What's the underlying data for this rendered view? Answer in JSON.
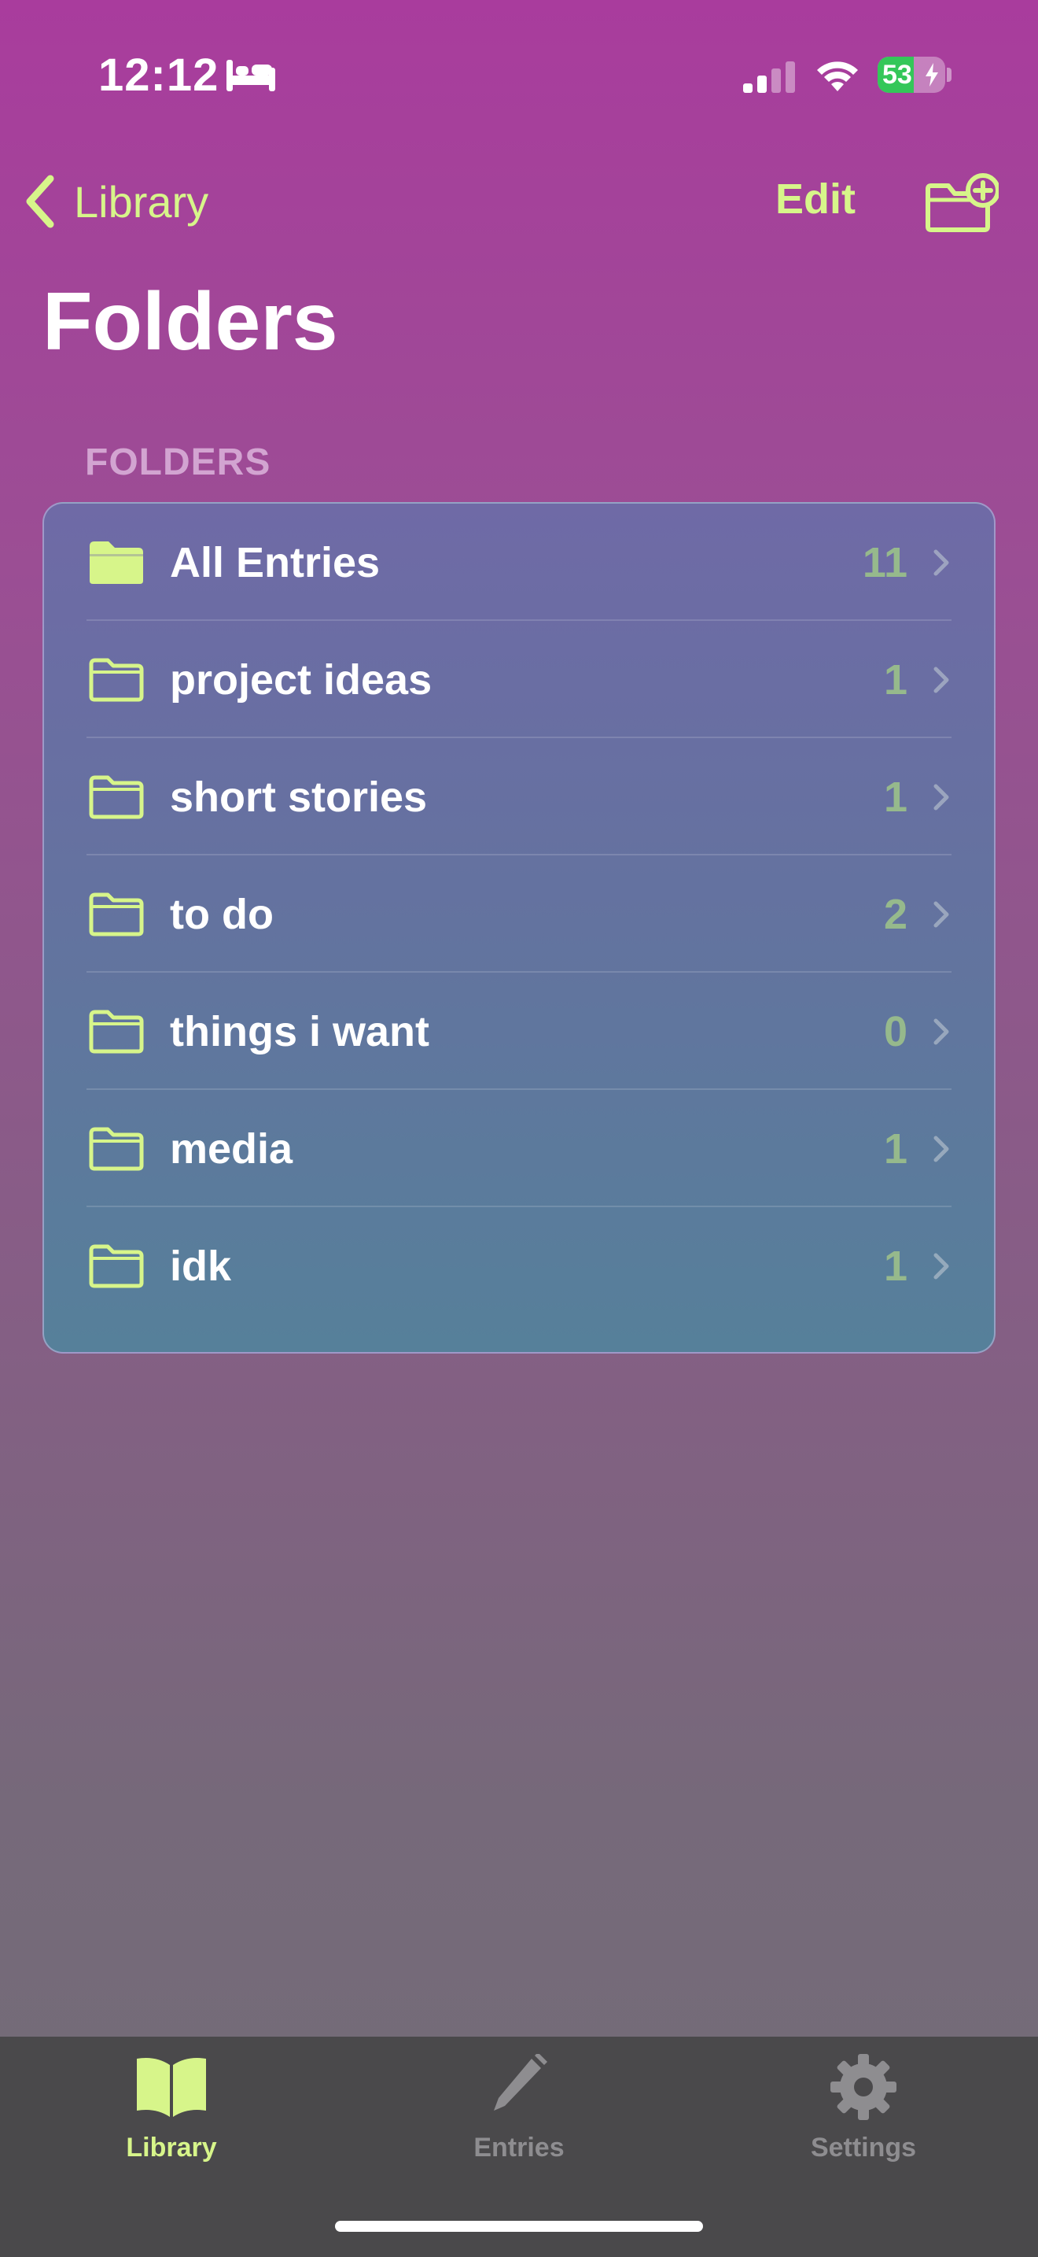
{
  "status_bar": {
    "time": "12:12",
    "battery_percent": "53",
    "battery_level": 0.53,
    "icons": [
      "bed-icon",
      "cellular-signal-icon",
      "wifi-icon",
      "battery-charging-icon"
    ]
  },
  "nav": {
    "back_label": "Library",
    "edit_label": "Edit",
    "new_folder_icon": "folder-plus-icon"
  },
  "page": {
    "title": "Folders",
    "section_header": "FOLDERS"
  },
  "folders": [
    {
      "name": "All Entries",
      "count": "11",
      "icon": "folder-filled-icon"
    },
    {
      "name": "project ideas",
      "count": "1",
      "icon": "folder-outline-icon"
    },
    {
      "name": "short stories",
      "count": "1",
      "icon": "folder-outline-icon"
    },
    {
      "name": "to do",
      "count": "2",
      "icon": "folder-outline-icon"
    },
    {
      "name": "things i want",
      "count": "0",
      "icon": "folder-outline-icon"
    },
    {
      "name": "media",
      "count": "1",
      "icon": "folder-outline-icon"
    },
    {
      "name": "idk",
      "count": "1",
      "icon": "folder-outline-icon"
    }
  ],
  "tab_bar": {
    "tabs": [
      {
        "label": "Library",
        "icon": "book-icon",
        "selected": true
      },
      {
        "label": "Entries",
        "icon": "pencil-icon",
        "selected": false
      },
      {
        "label": "Settings",
        "icon": "gear-icon",
        "selected": false
      }
    ]
  },
  "colors": {
    "accent": "#d7f58a",
    "count_text": "#96b98c",
    "tab_bar_bg": "#4a494b",
    "inactive_tab": "#8e8d90",
    "battery_green": "#34c759"
  }
}
